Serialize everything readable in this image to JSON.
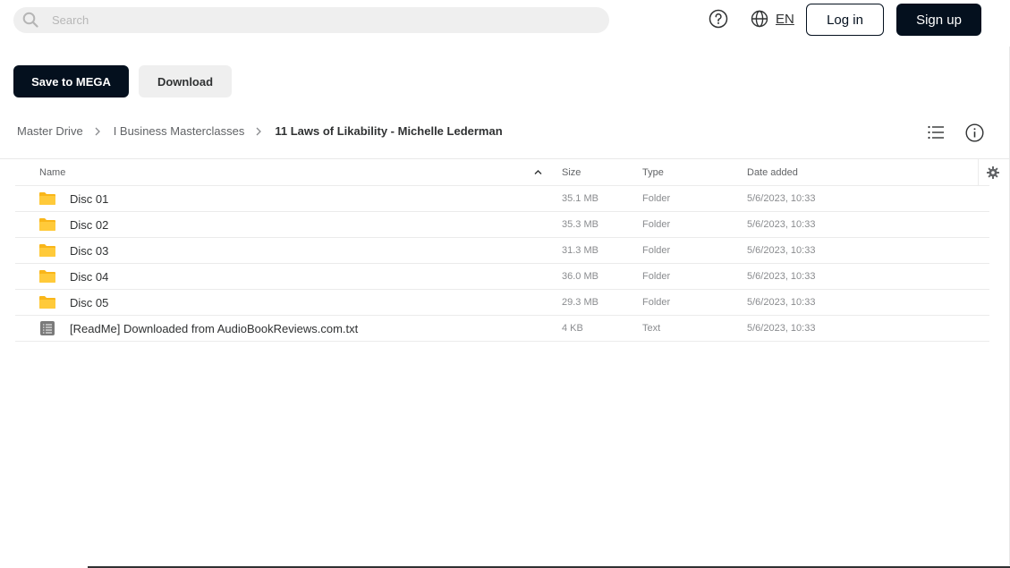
{
  "search": {
    "placeholder": "Search"
  },
  "header": {
    "language": "EN",
    "login_label": "Log in",
    "signup_label": "Sign up"
  },
  "actions": {
    "save_label": "Save to MEGA",
    "download_label": "Download"
  },
  "breadcrumb": [
    "Master Drive",
    "I Business Masterclasses",
    "11 Laws of Likability - Michelle Lederman"
  ],
  "table": {
    "headers": {
      "name": "Name",
      "size": "Size",
      "type": "Type",
      "date": "Date added"
    },
    "rows": [
      {
        "name": "Disc 01",
        "size": "35.1 MB",
        "type": "Folder",
        "date": "5/6/2023, 10:33",
        "icon": "folder-icon"
      },
      {
        "name": "Disc 02",
        "size": "35.3 MB",
        "type": "Folder",
        "date": "5/6/2023, 10:33",
        "icon": "folder-icon"
      },
      {
        "name": "Disc 03",
        "size": "31.3 MB",
        "type": "Folder",
        "date": "5/6/2023, 10:33",
        "icon": "folder-icon"
      },
      {
        "name": "Disc 04",
        "size": "36.0 MB",
        "type": "Folder",
        "date": "5/6/2023, 10:33",
        "icon": "folder-icon"
      },
      {
        "name": "Disc 05",
        "size": "29.3 MB",
        "type": "Folder",
        "date": "5/6/2023, 10:33",
        "icon": "folder-icon"
      },
      {
        "name": "[ReadMe] Downloaded from AudioBookReviews.com.txt",
        "size": "4 KB",
        "type": "Text",
        "date": "5/6/2023, 10:33",
        "icon": "text-file-icon"
      }
    ]
  },
  "colors": {
    "primary_dark": "#04101e",
    "folder": "#f9b619",
    "text_file": "#7a7a7a"
  }
}
